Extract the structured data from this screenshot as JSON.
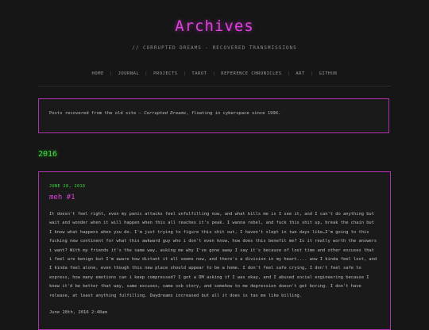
{
  "header": {
    "title": "Archives",
    "subtitle": "// CORRUPTED DREAMS - RECOVERED TRANSMISSIONS"
  },
  "nav": {
    "items": [
      {
        "label": "HOME"
      },
      {
        "label": "JOURNAL"
      },
      {
        "label": "PROJECTS"
      },
      {
        "label": "TAROT"
      },
      {
        "label": "REFERENCE CHRONICLES"
      },
      {
        "label": "ART"
      },
      {
        "label": "GITHUB"
      }
    ],
    "separator": "|"
  },
  "intro": {
    "text_before": "Posts recovered from the old site — ",
    "site_name": "Corrupted Dreams",
    "text_after": ", floating in cyberspace since 199X."
  },
  "archive": {
    "year": "2016",
    "post": {
      "date": "JUNE 28, 2016",
      "title": "meh #1",
      "body": "It doesn't feel right, even my panic attacks feel unfulfilling now, and what kills me is I see it, and I can't do anything but wait and wonder when it will happen when this all reaches it's peak. I wanna rebel, and fuck this shit up, break the chain but I know what happens when you do. I'm just trying to figure this shit out, I haven't slept in two days like…I'm going to this fucking new continent for what this awkward guy who i don't even know, how does this benefit me? Is it really worth the answers i want? With my friends it's the same way, asking me why I've gone away I say it's because of lost time and other excuses that i feel are benign but I'm aware how distant it all seems now, and there's a division in my heart.... wow I kinda feel lost, and I kinda feel alone, even though this new place should appear to be a home. I don't feel safe crying, I don't feel safe to express, how many emotions can i keep compressed? I got a DM asking if I was okay, and I abused social engineering because I knew it'd be better that way, same excuses, same sob story, and somehow to me depression doesn't get boring. I don't have release, at least anything fulfilling. Daydreams increased but all it does is tax me like billing.",
      "footer": "June 28th, 2016 2:48am"
    }
  },
  "colors": {
    "accent": "#e040e0",
    "green": "#3fe03f",
    "background": "#161616",
    "border": "#b030b0"
  }
}
